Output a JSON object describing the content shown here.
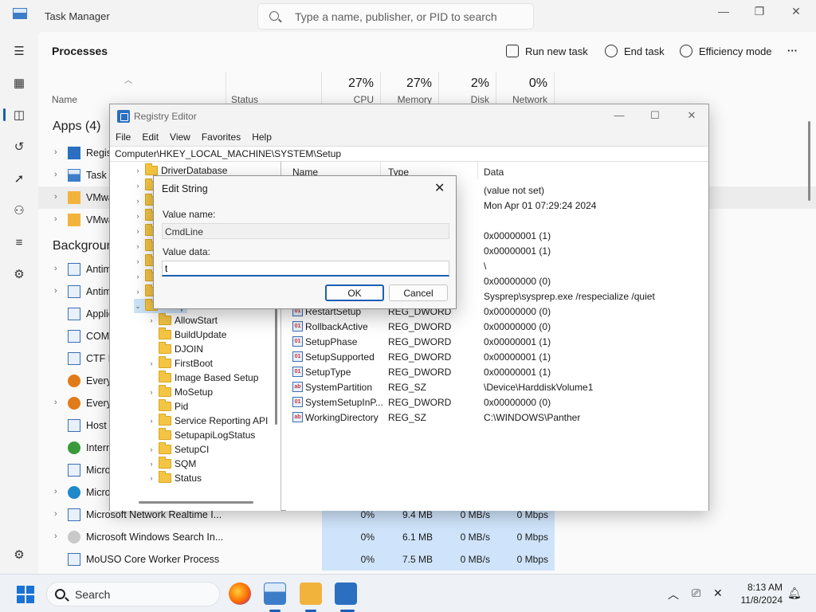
{
  "taskmanager": {
    "title": "Task Manager",
    "search_placeholder": "Type a name, publisher, or PID to search",
    "page_title": "Processes",
    "commands": {
      "run": "Run new task",
      "end": "End task",
      "efficiency": "Efficiency mode",
      "more": "···"
    },
    "columns": {
      "name": "Name",
      "status": "Status",
      "cpu_pct": "27%",
      "cpu": "CPU",
      "mem_pct": "27%",
      "mem": "Memory",
      "disk_pct": "2%",
      "disk": "Disk",
      "net_pct": "0%",
      "net": "Network"
    },
    "groups": {
      "apps": "Apps (4)",
      "background": "Backgroun"
    },
    "apps": [
      {
        "name": "Regist"
      },
      {
        "name": "Task M"
      },
      {
        "name": "VMwa"
      },
      {
        "name": "VMwa"
      }
    ],
    "background": [
      {
        "name": "Antim"
      },
      {
        "name": "Antim"
      },
      {
        "name": "Applic"
      },
      {
        "name": "COM"
      },
      {
        "name": "CTF L"
      },
      {
        "name": "Every"
      },
      {
        "name": "Every"
      },
      {
        "name": "Host"
      },
      {
        "name": "Intern"
      },
      {
        "name": "Micro"
      },
      {
        "name": "Micro"
      },
      {
        "name": "Microsoft Network Realtime I...",
        "cpu": "0%",
        "mem": "9.4 MB",
        "disk": "0 MB/s",
        "net": "0 Mbps"
      },
      {
        "name": "Microsoft Windows Search In...",
        "cpu": "0%",
        "mem": "6.1 MB",
        "disk": "0 MB/s",
        "net": "0 Mbps"
      },
      {
        "name": "MoUSO Core Worker Process",
        "cpu": "0%",
        "mem": "7.5 MB",
        "disk": "0 MB/s",
        "net": "0 Mbps"
      }
    ]
  },
  "regedit": {
    "title": "Registry Editor",
    "menu": [
      "File",
      "Edit",
      "View",
      "Favorites",
      "Help"
    ],
    "address": "Computer\\HKEY_LOCAL_MACHINE\\SYSTEM\\Setup",
    "tree": {
      "top": "DriverDatabase",
      "selected": "Setup",
      "children": [
        "AllowStart",
        "BuildUpdate",
        "DJOIN",
        "FirstBoot",
        "Image Based Setup",
        "MoSetup",
        "Pid",
        "Service Reporting API",
        "SetupapiLogStatus",
        "SetupCI",
        "SQM",
        "Status"
      ]
    },
    "list_headers": {
      "name": "Name",
      "type": "Type",
      "data": "Data"
    },
    "values": [
      {
        "name": "",
        "type": "",
        "data": "(value not set)"
      },
      {
        "name": "",
        "type": "",
        "data": "Mon Apr 01 07:29:24 2024"
      },
      {
        "name": "",
        "type": "",
        "data": "0x00000001 (1)"
      },
      {
        "name": "",
        "type": "",
        "data": "0x00000001 (1)"
      },
      {
        "name": "",
        "type": "",
        "data": "\\"
      },
      {
        "name": "",
        "type": "",
        "data": "0x00000000 (0)"
      },
      {
        "name": "",
        "type": "",
        "data": "Sysprep\\sysprep.exe /respecialize /quiet"
      },
      {
        "name": "RestartSetup",
        "type": "REG_DWORD",
        "data": "0x00000000 (0)"
      },
      {
        "name": "RollbackActive",
        "type": "REG_DWORD",
        "data": "0x00000000 (0)"
      },
      {
        "name": "SetupPhase",
        "type": "REG_DWORD",
        "data": "0x00000001 (1)"
      },
      {
        "name": "SetupSupported",
        "type": "REG_DWORD",
        "data": "0x00000001 (1)"
      },
      {
        "name": "SetupType",
        "type": "REG_DWORD",
        "data": "0x00000001 (1)"
      },
      {
        "name": "SystemPartition",
        "type": "REG_SZ",
        "data": "\\Device\\HarddiskVolume1"
      },
      {
        "name": "SystemSetupInP...",
        "type": "REG_DWORD",
        "data": "0x00000000 (0)"
      },
      {
        "name": "WorkingDirectory",
        "type": "REG_SZ",
        "data": "C:\\WINDOWS\\Panther"
      }
    ]
  },
  "edit_string": {
    "title": "Edit String",
    "close": "✕",
    "value_name_label": "Value name:",
    "value_name": "CmdLine",
    "value_data_label": "Value data:",
    "value_data": "t",
    "ok": "OK",
    "cancel": "Cancel"
  },
  "taskbar": {
    "search": "Search",
    "time": "8:13 AM",
    "date": "11/8/2024"
  },
  "colors": {
    "accent": "#1a5fb4",
    "heat": "#cfe4fb",
    "folder": "#f4c542"
  }
}
